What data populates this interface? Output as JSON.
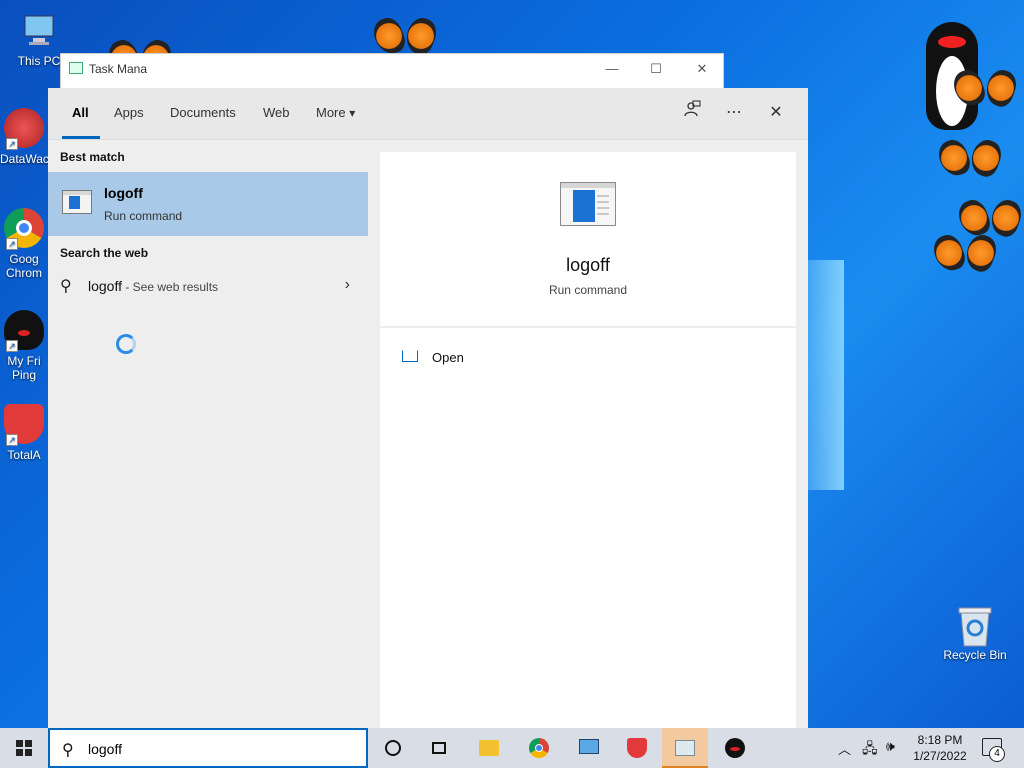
{
  "desktop": {
    "icons": [
      {
        "name": "this-pc",
        "label": "This PC"
      },
      {
        "name": "datawa",
        "label": "DataWac"
      },
      {
        "name": "chrome",
        "label": "Goog Chrom"
      },
      {
        "name": "pingu",
        "label": "My Fri Ping"
      },
      {
        "name": "totalav",
        "label": "TotalA"
      },
      {
        "name": "recycle-bin",
        "label": "Recycle Bin"
      }
    ]
  },
  "task_manager": {
    "title": "Task Mana"
  },
  "search": {
    "tabs": [
      {
        "label": "All",
        "active": true
      },
      {
        "label": "Apps"
      },
      {
        "label": "Documents"
      },
      {
        "label": "Web"
      },
      {
        "label": "More"
      }
    ],
    "more_caret": "▾",
    "best_match_header": "Best match",
    "best_match": {
      "name": "logoff",
      "type": "Run command"
    },
    "search_web_header": "Search the web",
    "web_result": {
      "query": "logoff",
      "hint": " - See web results"
    },
    "preview": {
      "name": "logoff",
      "type": "Run command"
    },
    "actions": [
      {
        "label": "Open"
      }
    ],
    "query": "logoff"
  },
  "taskbar": {
    "clock_time": "8:18 PM",
    "clock_date": "1/27/2022",
    "notification_count": "4"
  },
  "colors": {
    "accent": "#0067c0",
    "selection": "#a8c9e8"
  }
}
